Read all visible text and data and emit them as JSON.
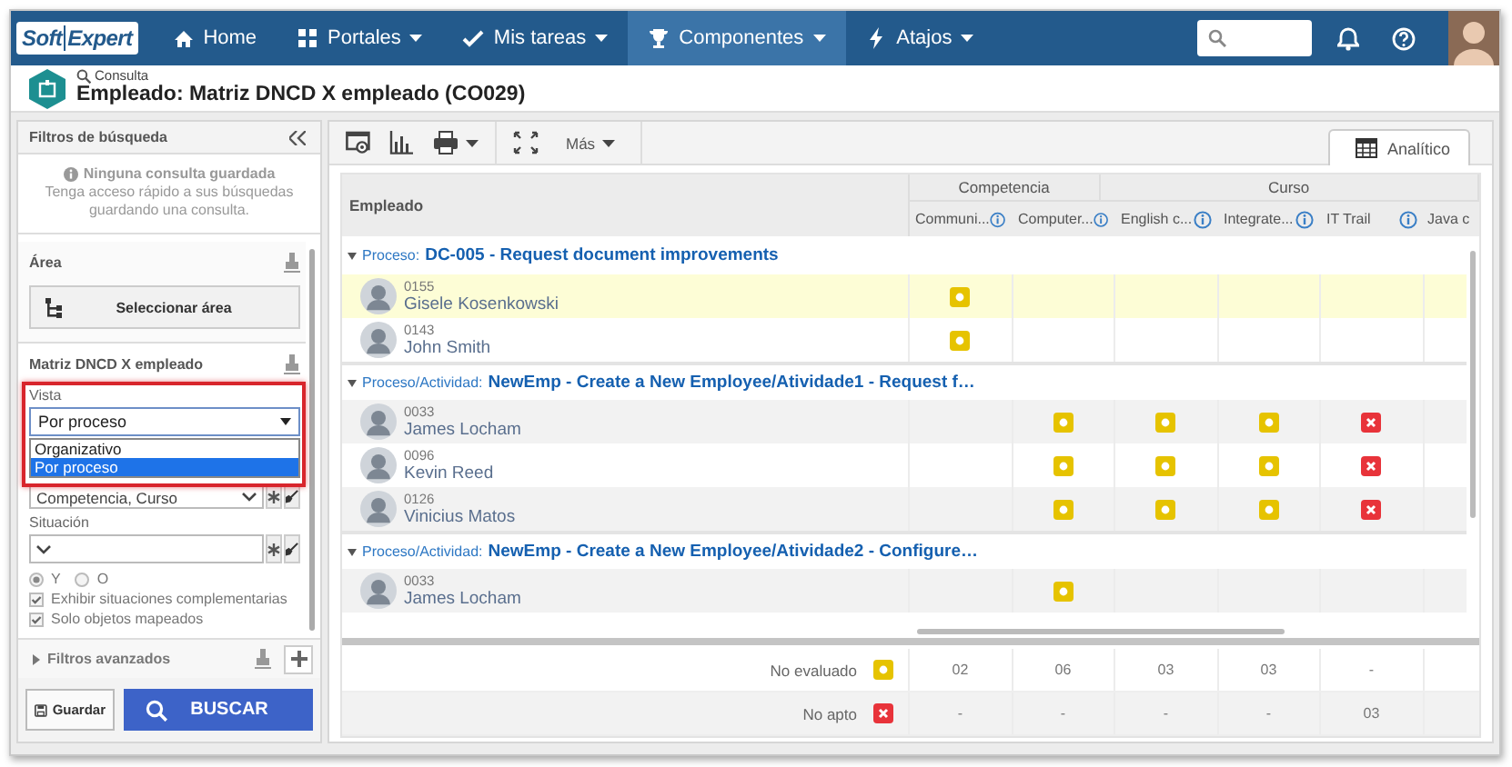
{
  "nav": {
    "logo": [
      "Soft",
      "Expert"
    ],
    "items": [
      {
        "label": "Home",
        "dropdown": false,
        "selected": false
      },
      {
        "label": "Portales",
        "dropdown": true,
        "selected": false
      },
      {
        "label": "Mis tareas",
        "dropdown": true,
        "selected": false
      },
      {
        "label": "Componentes",
        "dropdown": true,
        "selected": true
      },
      {
        "label": "Atajos",
        "dropdown": true,
        "selected": false
      }
    ]
  },
  "page_header": {
    "breadcrumb": "Consulta",
    "title": "Empleado: Matriz DNCD X empleado (CO029)"
  },
  "filters": {
    "title": "Filtros de búsqueda",
    "saved_notice": "Ninguna consulta guardada",
    "saved_hint": "Tenga acceso rápido a sus búsquedas guardando una consulta.",
    "area": {
      "title": "Área",
      "button": "Seleccionar área"
    },
    "matrix": {
      "title": "Matriz DNCD X empleado",
      "view": {
        "label": "Vista",
        "value": "Por proceso",
        "expanded": true,
        "annotated": true,
        "options": [
          {
            "label": "Organizativo",
            "selected": false
          },
          {
            "label": "Por proceso",
            "selected": true
          }
        ]
      },
      "requirement": {
        "value": "Competencia, Curso"
      },
      "situation": {
        "label": "Situación"
      },
      "logic": [
        {
          "label": "Y",
          "selected": true
        },
        {
          "label": "O",
          "selected": false
        }
      ],
      "checks": [
        {
          "label": "Exhibir situaciones complementarias",
          "checked": true
        },
        {
          "label": "Solo objetos mapeados",
          "checked": true
        }
      ]
    },
    "advanced": {
      "label": "Filtros avanzados",
      "expanded": false
    }
  },
  "actions": {
    "save": "Guardar",
    "search": "BUSCAR"
  },
  "toolbar": {
    "more": "Más"
  },
  "tab": {
    "label": "Analítico",
    "selected": true
  },
  "grid": {
    "first_column": "Empleado",
    "column_groups": [
      {
        "label": "Competencia"
      },
      {
        "label": "Curso"
      }
    ],
    "columns": [
      {
        "label": "Communi...",
        "info": true
      },
      {
        "label": "Computer...",
        "info": true
      },
      {
        "label": "English c...",
        "info": true
      },
      {
        "label": "Integrate...",
        "info": true
      },
      {
        "label": "IT Trail",
        "info": true
      },
      {
        "label": "Java c",
        "info": false
      }
    ],
    "groups": [
      {
        "label": "Proceso:",
        "title": "DC-005 - Request document improvements",
        "expanded": true,
        "rows": [
          {
            "code": "0155",
            "name": "Gisele Kosenkowski",
            "highlighted": true,
            "cells": [
              {
                "kind": "not_evaluated"
              },
              {
                "kind": "empty"
              },
              {
                "kind": "empty"
              },
              {
                "kind": "empty"
              },
              {
                "kind": "empty"
              },
              {
                "kind": "empty"
              }
            ]
          },
          {
            "code": "0143",
            "name": "John Smith",
            "highlighted": false,
            "cells": [
              {
                "kind": "not_evaluated"
              },
              {
                "kind": "empty"
              },
              {
                "kind": "empty"
              },
              {
                "kind": "empty"
              },
              {
                "kind": "empty"
              },
              {
                "kind": "empty"
              }
            ]
          }
        ]
      },
      {
        "label": "Proceso/Actividad:",
        "title": "NewEmp - Create a New Employee/Atividade1 - Request f…",
        "expanded": true,
        "rows": [
          {
            "code": "0033",
            "name": "James Locham",
            "highlighted": false,
            "cells": [
              {
                "kind": "empty"
              },
              {
                "kind": "not_evaluated"
              },
              {
                "kind": "not_evaluated"
              },
              {
                "kind": "not_evaluated"
              },
              {
                "kind": "not_fit"
              },
              {
                "kind": "empty"
              }
            ]
          },
          {
            "code": "0096",
            "name": "Kevin Reed",
            "highlighted": false,
            "cells": [
              {
                "kind": "empty"
              },
              {
                "kind": "not_evaluated"
              },
              {
                "kind": "not_evaluated"
              },
              {
                "kind": "not_evaluated"
              },
              {
                "kind": "not_fit"
              },
              {
                "kind": "empty"
              }
            ]
          },
          {
            "code": "0126",
            "name": "Vinicius Matos",
            "highlighted": false,
            "cells": [
              {
                "kind": "empty"
              },
              {
                "kind": "not_evaluated"
              },
              {
                "kind": "not_evaluated"
              },
              {
                "kind": "not_evaluated"
              },
              {
                "kind": "not_fit"
              },
              {
                "kind": "empty"
              }
            ]
          }
        ]
      },
      {
        "label": "Proceso/Actividad:",
        "title": "NewEmp - Create a New Employee/Atividade2 - Configure…",
        "expanded": true,
        "rows": [
          {
            "code": "0033",
            "name": "James Locham",
            "highlighted": false,
            "cells": [
              {
                "kind": "empty"
              },
              {
                "kind": "not_evaluated"
              },
              {
                "kind": "empty"
              },
              {
                "kind": "empty"
              },
              {
                "kind": "empty"
              },
              {
                "kind": "empty"
              }
            ]
          }
        ]
      }
    ],
    "summary": [
      {
        "label": "No evaluado",
        "kind": "not_evaluated",
        "values": [
          "02",
          "06",
          "03",
          "03",
          "-"
        ]
      },
      {
        "label": "No apto",
        "kind": "not_fit",
        "values": [
          "-",
          "-",
          "-",
          "-",
          "03"
        ]
      }
    ]
  }
}
